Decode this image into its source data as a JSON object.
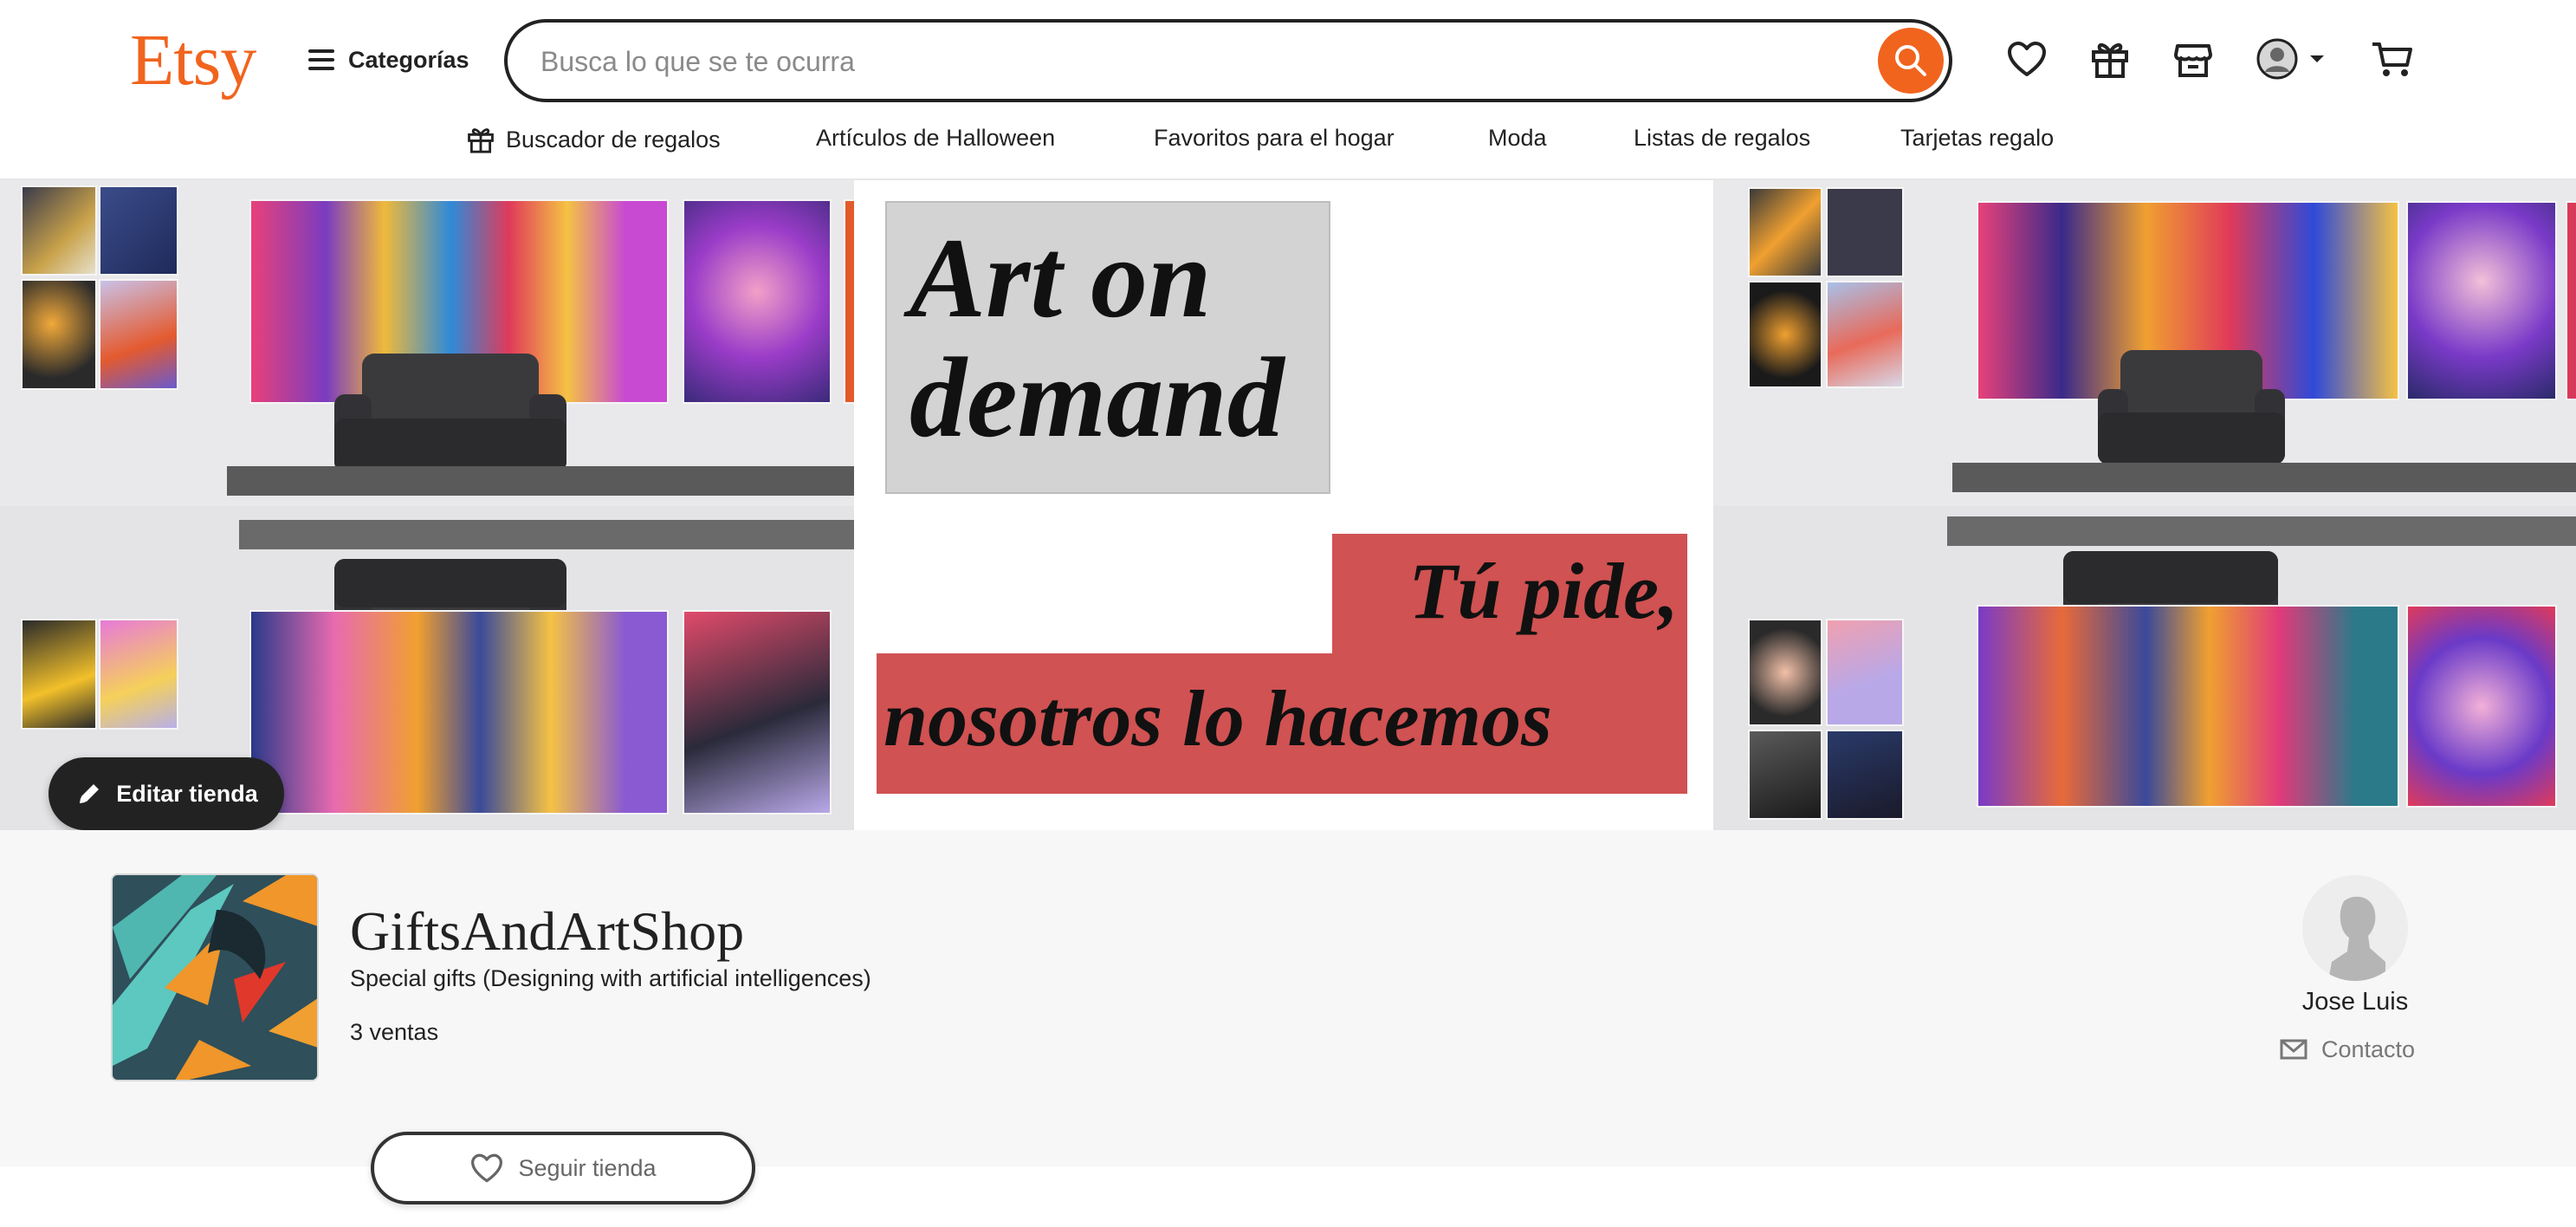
{
  "brand": {
    "logo": "Etsy",
    "accent_color": "#f1641e"
  },
  "header": {
    "categories_label": "Categorías",
    "search_placeholder": "Busca lo que se te ocurra",
    "icons": [
      "heart-icon",
      "gift-icon",
      "shop-icon",
      "account-icon",
      "cart-icon"
    ]
  },
  "subnav": {
    "items": [
      "Buscador de regalos",
      "Artículos de Halloween",
      "Favoritos para el hogar",
      "Moda",
      "Listas de regalos",
      "Tarjetas regalo"
    ]
  },
  "banner": {
    "headline": "Art on demand",
    "slogan_line1": "Tú pide,",
    "slogan_line2": "nosotros lo hacemos",
    "edit_button": "Editar tienda"
  },
  "shop": {
    "name": "GiftsAndArtShop",
    "tagline": "Special gifts (Designing with artificial intelligences)",
    "sales": "3 ventas",
    "owner_name": "Jose Luis",
    "contact_label": "Contacto",
    "follow_label": "Seguir tienda"
  }
}
